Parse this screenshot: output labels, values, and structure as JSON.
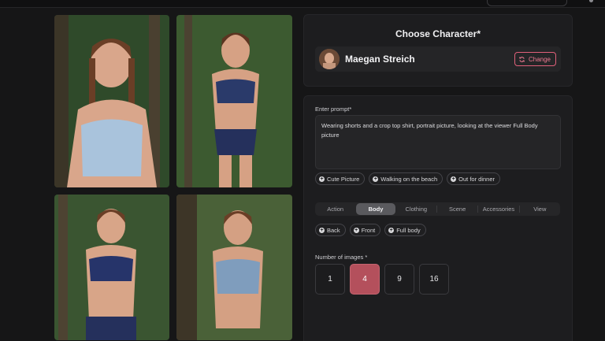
{
  "character": {
    "title": "Choose Character*",
    "name": "Maegan Streich",
    "change_label": "Change"
  },
  "prompt": {
    "label": "Enter prompt*",
    "value": "Wearing shorts and a crop top shirt, portrait picture, looking at the viewer  Full Body picture"
  },
  "suggestions": [
    "Cute Picture",
    "Walking on the beach",
    "Out for dinner"
  ],
  "tabs": {
    "items": [
      "Action",
      "Body",
      "Clothing",
      "Scene",
      "Accessories",
      "View"
    ],
    "active": "Body"
  },
  "body_options": [
    "Back",
    "Front",
    "Full body"
  ],
  "num_images": {
    "label": "Number of images *",
    "options": [
      "1",
      "4",
      "9",
      "16"
    ],
    "selected": "4"
  },
  "colors": {
    "accent": "#b4505c",
    "change_border": "#e0607a",
    "background": "#161617",
    "panel": "#1d1d1f"
  }
}
